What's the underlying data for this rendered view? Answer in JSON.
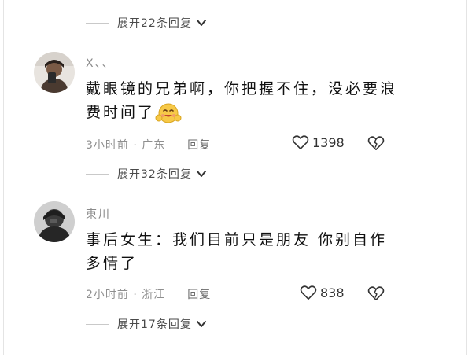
{
  "threads": [
    {
      "expand_label": "展开22条回复"
    },
    {
      "expand_label": "展开32条回复"
    },
    {
      "expand_label": "展开17条回复"
    }
  ],
  "comments": [
    {
      "username": "X、、",
      "text": "戴眼镜的兄弟啊，你把握不住，没必要浪费时间了",
      "emoji_icon": "hugging-face-icon",
      "time_location": "3小时前 · 广东",
      "reply_label": "回复",
      "like_count": "1398"
    },
    {
      "username": "東川",
      "text": "事后女生：我们目前只是朋友 你别自作多情了",
      "time_location": "2小时前 · 浙江",
      "reply_label": "回复",
      "like_count": "838"
    }
  ],
  "colors": {
    "text": "#111111",
    "meta": "#8f8f8f",
    "divider": "#c9c9c9"
  }
}
